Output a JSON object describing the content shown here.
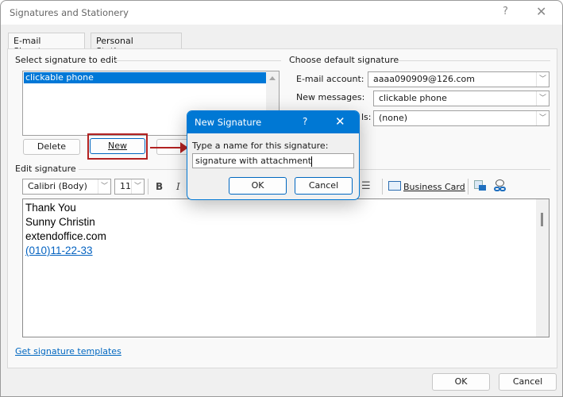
{
  "window": {
    "title": "Signatures and Stationery",
    "help_glyph": "?",
    "close_glyph": "✕"
  },
  "tabs": [
    {
      "label": "E-mail Signature",
      "accel": "E",
      "active": true
    },
    {
      "label": "Personal Stationery",
      "accel": "P",
      "active": false
    }
  ],
  "select_group": {
    "label": "Select signature to edit",
    "items": [
      "clickable phone"
    ],
    "selected": "clickable phone"
  },
  "sig_buttons": {
    "delete": "Delete",
    "new": "New"
  },
  "default_group": {
    "label": "Choose default signature",
    "email_account_label": "E-mail account:",
    "email_account_value": "aaaa090909@126.com",
    "new_messages_label": "New messages:",
    "new_messages_value": "clickable phone",
    "replies_label": "Replies/forwards:",
    "replies_partial": "ls:",
    "replies_value": "(none)"
  },
  "edit_group": {
    "label": "Edit signature",
    "font": "Calibri (Body)",
    "size": "11",
    "bold": "B",
    "italic": "I",
    "business_card": "Business Card",
    "lines": [
      "Thank You",
      "Sunny Christin",
      "extendoffice.com"
    ],
    "phone_link": "(010)11-22-33"
  },
  "footer": {
    "templates_link": "Get signature templates",
    "ok": "OK",
    "cancel": "Cancel"
  },
  "modal": {
    "title": "New Signature",
    "help_glyph": "?",
    "close_glyph": "✕",
    "prompt": "Type a name for this signature:",
    "value": "signature with attachment",
    "ok": "OK",
    "cancel": "Cancel"
  },
  "colors": {
    "accent": "#0078d4",
    "selection": "#0078d7",
    "link": "#0563c1",
    "highlight": "#b22222"
  }
}
